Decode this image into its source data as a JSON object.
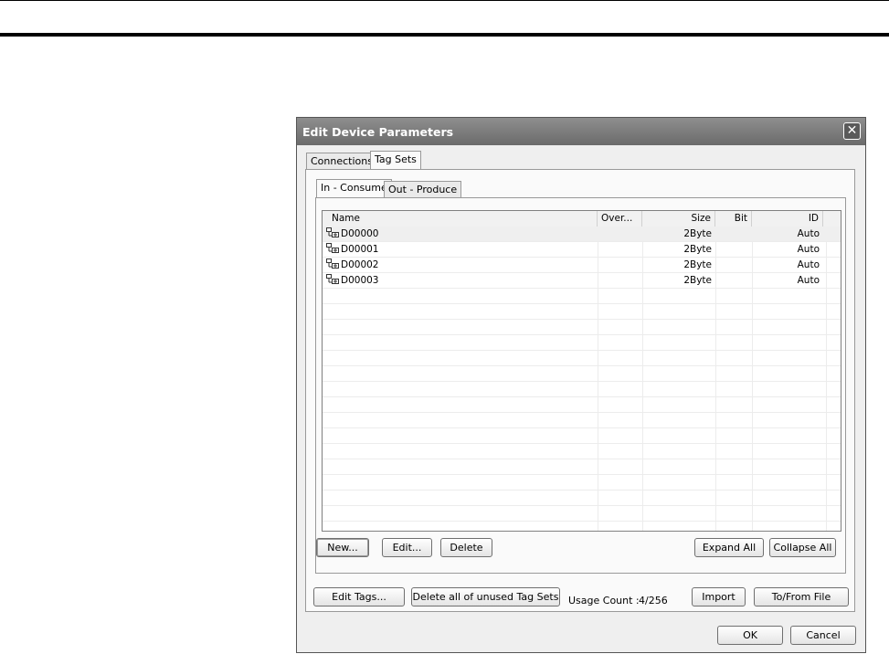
{
  "dialog": {
    "title": "Edit Device Parameters",
    "close_glyph": "✕"
  },
  "outer_tabs": [
    {
      "label": "Connections",
      "active": false
    },
    {
      "label": "Tag Sets",
      "active": true
    }
  ],
  "inner_tabs": [
    {
      "label": "In - Consume",
      "active": true
    },
    {
      "label": "Out - Produce",
      "active": false
    }
  ],
  "list": {
    "columns": [
      "Name",
      "Over...",
      "Size",
      "Bit",
      "ID"
    ],
    "rows": [
      {
        "name": "D00000",
        "over": "",
        "size": "2Byte",
        "bit": "",
        "id": "Auto",
        "selected": true
      },
      {
        "name": "D00001",
        "over": "",
        "size": "2Byte",
        "bit": "",
        "id": "Auto",
        "selected": false
      },
      {
        "name": "D00002",
        "over": "",
        "size": "2Byte",
        "bit": "",
        "id": "Auto",
        "selected": false
      },
      {
        "name": "D00003",
        "over": "",
        "size": "2Byte",
        "bit": "",
        "id": "Auto",
        "selected": false
      }
    ],
    "row_icon": "tag-set-tree-icon"
  },
  "inner_buttons": {
    "new": "New...",
    "edit": "Edit...",
    "delete": "Delete",
    "expand_all": "Expand All",
    "collapse_all": "Collapse All"
  },
  "outer_buttons": {
    "edit_tags": "Edit Tags...",
    "delete_unused": "Delete all of unused Tag Sets",
    "import": "Import",
    "to_from_file": "To/From File"
  },
  "usage": {
    "label": "Usage Count :",
    "value": "4/256"
  },
  "footer": {
    "ok": "OK",
    "cancel": "Cancel"
  },
  "colors": {
    "titlebar": "#7a7a7a",
    "dialog_bg": "#efefef",
    "selected_row": "#efefef"
  }
}
